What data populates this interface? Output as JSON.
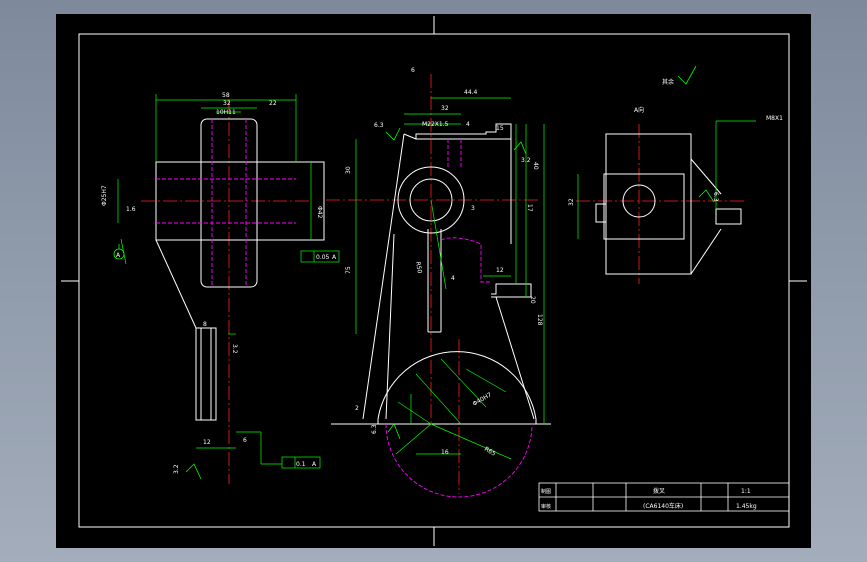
{
  "colors": {
    "background": "#000000",
    "outline": "#ffffff",
    "centerline": "#ff2020",
    "dimension": "#00ff00",
    "hidden": "#ff00ff",
    "viewport": "#8e9aab"
  },
  "front_view": {
    "dims": {
      "top_width": "58",
      "inner_width": "32",
      "right_offset": "22",
      "bore_label": "10H11",
      "left_dia": "Φ25H7",
      "right_dia": "Φ42",
      "roughness_left": "1.6",
      "gd_t": "0.05",
      "gd_ref": "A",
      "datum_a": "A",
      "slot_w": "8",
      "slot_depth": "3.2",
      "bottom_left": "12",
      "bottom_right": "6",
      "bottom_gd": "0.1",
      "bottom_ref": "A",
      "roughness_bottom": "3.2"
    }
  },
  "side_view": {
    "dims": {
      "top_label": "6",
      "top_width": "44.4",
      "sub_32": "32",
      "thread": "M22X1.5",
      "thread_4": "4",
      "dim_15": "15",
      "roughness_top": "6.3",
      "roughness_right": "3.2",
      "h_30": "30",
      "h_40": "40",
      "h_75": "75",
      "h_17": "17",
      "w_12": "12",
      "dim_20": "20",
      "h_128": "128",
      "dim_4": "4",
      "rad_r50": "R50",
      "angle_label": "Φ40H7",
      "rad_r65": "R65",
      "bottom_16": "16",
      "roughness_bottom": "6.3",
      "left_marker": "2",
      "mid_3": "3"
    }
  },
  "right_view": {
    "dims": {
      "top": "A向",
      "right_label": "M8X1",
      "left_h": "32",
      "roughness": "6.3"
    }
  },
  "general_roughness": "其余",
  "title_block": {
    "part_name": "拨叉",
    "machine": "(CA6140车床)",
    "scale": "1:1",
    "weight": "1.45kg",
    "row1_label": "制图",
    "row2_label": "审核"
  }
}
